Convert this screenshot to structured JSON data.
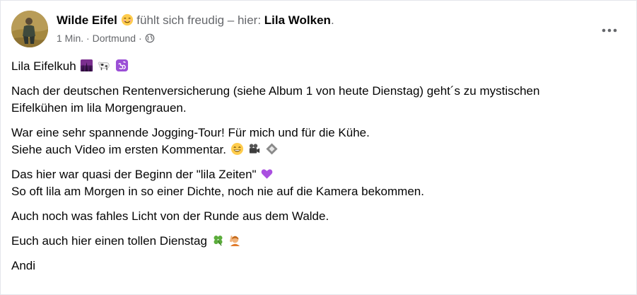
{
  "post": {
    "author": "Wilde Eifel",
    "feeling_text": "fühlt sich freudig – hier:",
    "place": "Lila Wolken",
    "place_suffix": ".",
    "time": "1 Min.",
    "separator": "·",
    "location": "Dortmund",
    "audience_icon": "globe-icon",
    "more_icon": "more-options-icon"
  },
  "body": {
    "p1": "Lila Eifelkuh",
    "p2_line1": "Nach der deutschen Rentenversicherung (siehe Album 1 von heute Dienstag) geht´s zu mystischen",
    "p2_line2": "Eifelkühen im lila Morgengrauen.",
    "p3_line1": "War eine sehr spannende Jogging-Tour! Für mich und für die Kühe.",
    "p3_line2": "Siehe auch Video im ersten Kommentar.",
    "p4_line1": "Das hier war quasi der Beginn der \"lila Zeiten\"",
    "p4_line2": "So oft lila am Morgen in so einer Dichte, noch nie auf die Kamera bekommen.",
    "p5": "Auch noch was fahles Licht von der Runde aus dem Walde.",
    "p6": "Euch auch hier einen tollen Dienstag",
    "p7": "Andi"
  },
  "icons": {
    "feeling": "smiling-face-icon",
    "p1": [
      "purple-sunrise-icon",
      "cow-icon",
      "om-symbol-icon"
    ],
    "p3": [
      "grinning-face-icon",
      "movie-camera-icon",
      "film-frames-icon"
    ],
    "p4": [
      "purple-heart-icon"
    ],
    "p6": [
      "four-leaf-clover-icon",
      "person-raising-hand-icon"
    ]
  },
  "colors": {
    "text": "#050505",
    "secondary": "#65676b",
    "purple": "#9b4fd6",
    "clover": "#5cad3c"
  }
}
